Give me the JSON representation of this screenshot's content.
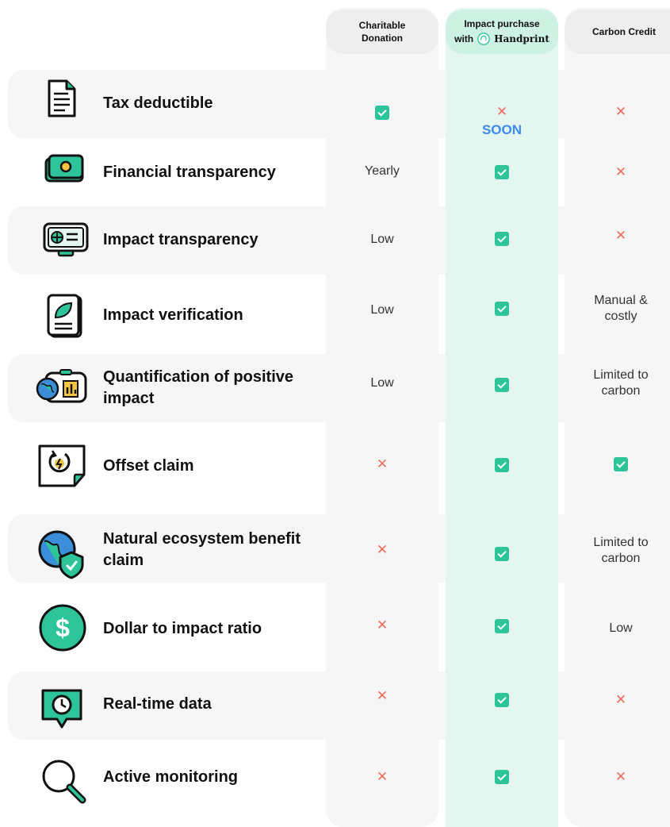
{
  "columns": {
    "charitable": "Charitable\nDonation",
    "impact_line1": "Impact purchase",
    "impact_with": "with",
    "impact_brand": "Handprint",
    "carbon": "Carbon Credit"
  },
  "colors": {
    "check": "#2ec49a",
    "cross": "#ef6b5b",
    "soon": "#3b8bf0",
    "accent_bg": "#e3f6f0"
  },
  "rows": [
    {
      "label": "Tax deductible",
      "icon": "document-icon",
      "charitable": "check",
      "impact": "cross",
      "impact_note": "SOON",
      "carbon": "cross"
    },
    {
      "label": "Financial transparency",
      "icon": "money-icon",
      "charitable": "Yearly",
      "impact": "check",
      "carbon": "cross"
    },
    {
      "label": "Impact transparency",
      "icon": "chart-board-icon",
      "charitable": "Low",
      "impact": "check",
      "carbon": "cross"
    },
    {
      "label": "Impact verification",
      "icon": "certificate-leaf-icon",
      "charitable": "Low",
      "impact": "check",
      "carbon": "Manual & costly"
    },
    {
      "label": "Quantification of positive impact",
      "icon": "globe-chart-icon",
      "charitable": "Low",
      "impact": "check",
      "carbon": "Limited to carbon"
    },
    {
      "label": "Offset claim",
      "icon": "offset-cycle-icon",
      "charitable": "cross",
      "impact": "check",
      "carbon": "check"
    },
    {
      "label": "Natural ecosystem benefit claim",
      "icon": "globe-shield-icon",
      "charitable": "cross",
      "impact": "check",
      "carbon": "Limited to carbon"
    },
    {
      "label": "Dollar to impact ratio",
      "icon": "dollar-icon",
      "charitable": "cross",
      "impact": "check",
      "carbon": "Low"
    },
    {
      "label": "Real-time data",
      "icon": "clock-chat-icon",
      "charitable": "cross",
      "impact": "check",
      "carbon": "cross"
    },
    {
      "label": "Active monitoring",
      "icon": "magnifier-icon",
      "charitable": "cross",
      "impact": "check",
      "carbon": "cross"
    }
  ]
}
